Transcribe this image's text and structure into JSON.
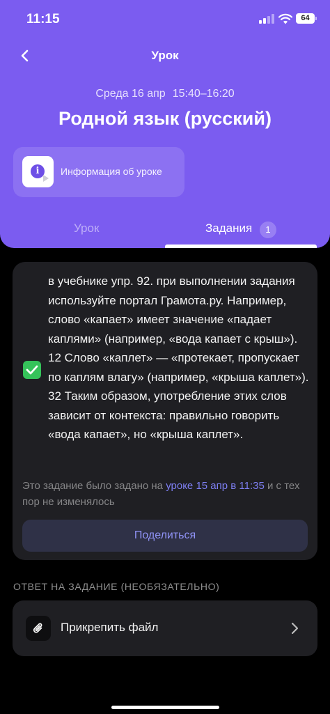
{
  "status_bar": {
    "time": "11:15",
    "battery": "64"
  },
  "nav": {
    "title": "Урок",
    "back_icon": "chevron-left-icon"
  },
  "lesson": {
    "date": "Среда 16 апр",
    "time_range": "15:40–16:20",
    "title": "Родной язык (русский)"
  },
  "info_card": {
    "label": "Информация об уроке",
    "icon": "info-icon"
  },
  "tabs": [
    {
      "label": "Урок",
      "active": false
    },
    {
      "label": "Задания",
      "active": true,
      "badge": "1"
    }
  ],
  "task": {
    "completed": true,
    "text": "в учебнике упр. 92. при выполнении задания используйте портал Грамота.ру. Например, слово «капает» имеет значение «падает каплями» (например, «вода капает с крыш»). 12 Слово «каплет» — «протекает, пропускает по каплям влагу» (например, «крыша каплет»). 32 Таким образом, употребление этих слов зависит от контекста: правильно говорить «вода капает», но «крыша каплет».",
    "note_prefix": "Это задание было задано на ",
    "note_link": "уроке 15 апр в 11:35",
    "note_suffix": " и с тех пор не изменялось",
    "share_label": "Поделиться"
  },
  "answer": {
    "heading": "ОТВЕТ НА ЗАДАНИЕ (НЕОБЯЗАТЕЛЬНО)",
    "attach_label": "Прикрепить файл"
  },
  "colors": {
    "header": "#7b5cf0",
    "card": "#1f1f23",
    "check": "#35c35a",
    "link": "#7e7ff3",
    "share_text": "#8f92f5",
    "share_bg": "#2f3147"
  }
}
